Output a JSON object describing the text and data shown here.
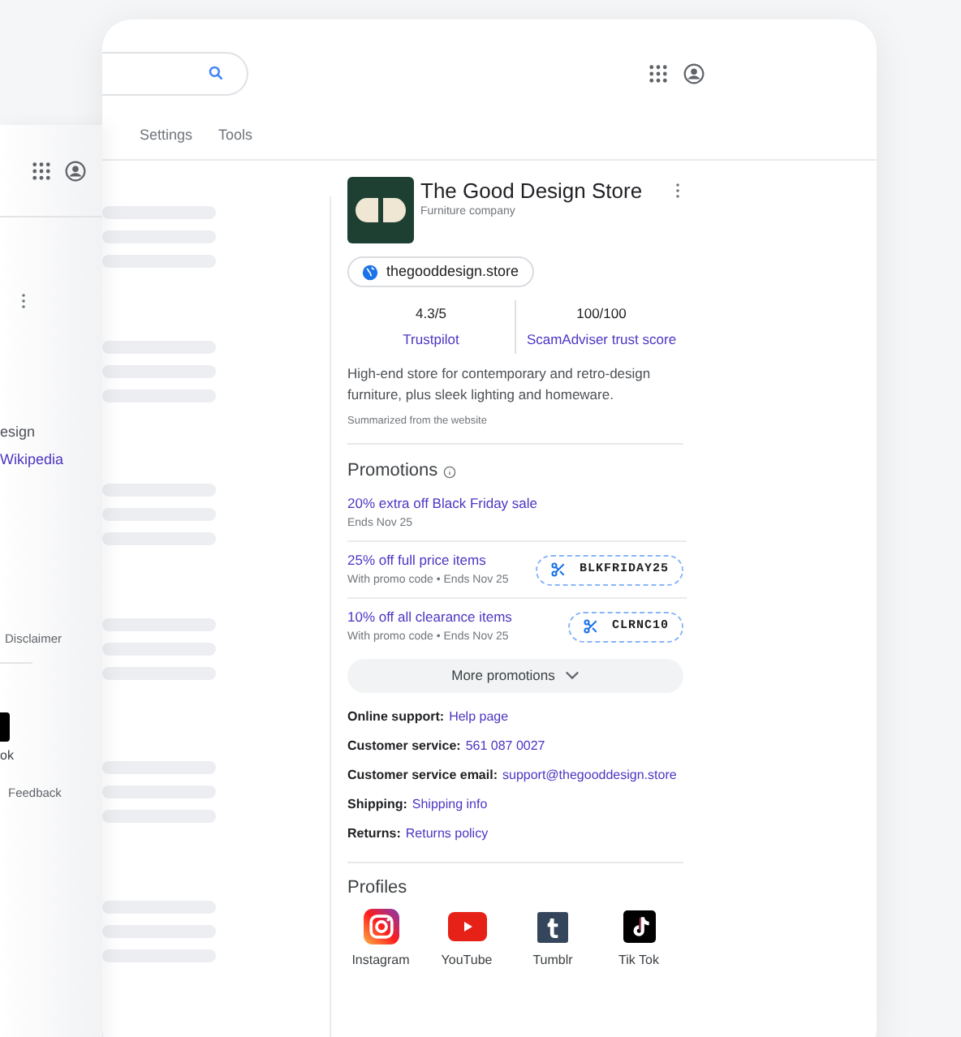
{
  "back_window": {
    "texts": [
      {
        "kind": "text",
        "text": "esign"
      },
      {
        "kind": "link",
        "text": "Wikipedia"
      }
    ],
    "disclaimer": "Disclaimer",
    "app_label": "ok",
    "feedback": "Feedback"
  },
  "main_window": {
    "tabs": [
      {
        "label": "Settings",
        "selected": false
      },
      {
        "label": "Tools",
        "selected": false
      }
    ]
  },
  "knowledge_panel": {
    "title": "The Good Design Store",
    "subtitle": "Furniture company",
    "website": "thegooddesign.store",
    "ratings": [
      {
        "score": "4.3/5",
        "source": "Trustpilot"
      },
      {
        "score": "100/100",
        "source": "ScamAdviser trust score"
      }
    ],
    "description": "High-end store for contemporary and retro-design furniture, plus sleek lighting and homeware.",
    "summary_note": "Summarized from the website",
    "promotions_title": "Promotions",
    "promotions": [
      {
        "kind": "plain",
        "title": "20% extra off Black Friday sale",
        "detail": "Ends Nov 25"
      },
      {
        "kind": "code",
        "title": "25% off full price items",
        "detail": "With promo code • Ends Nov 25",
        "code": "BLKFRIDAY25"
      },
      {
        "kind": "code",
        "title": "10% off all clearance items",
        "detail": "With promo code • Ends Nov 25",
        "code": "CLRNC10"
      }
    ],
    "more_button": "More promotions",
    "info": [
      {
        "label": "Online support:",
        "value": "Help page"
      },
      {
        "label": "Customer service:",
        "value": "561 087 0027"
      },
      {
        "label": "Customer service email:",
        "value": "support@thegooddesign.store"
      },
      {
        "label": "Shipping:",
        "value": "Shipping info"
      },
      {
        "label": "Returns:",
        "value": "Returns policy"
      }
    ],
    "profiles_title": "Profiles",
    "profiles": [
      {
        "kind": "instagram",
        "label": "Instagram"
      },
      {
        "kind": "youtube",
        "label": "YouTube"
      },
      {
        "kind": "tumblr",
        "label": "Tumblr"
      },
      {
        "kind": "tiktok",
        "label": "Tik Tok"
      }
    ]
  }
}
